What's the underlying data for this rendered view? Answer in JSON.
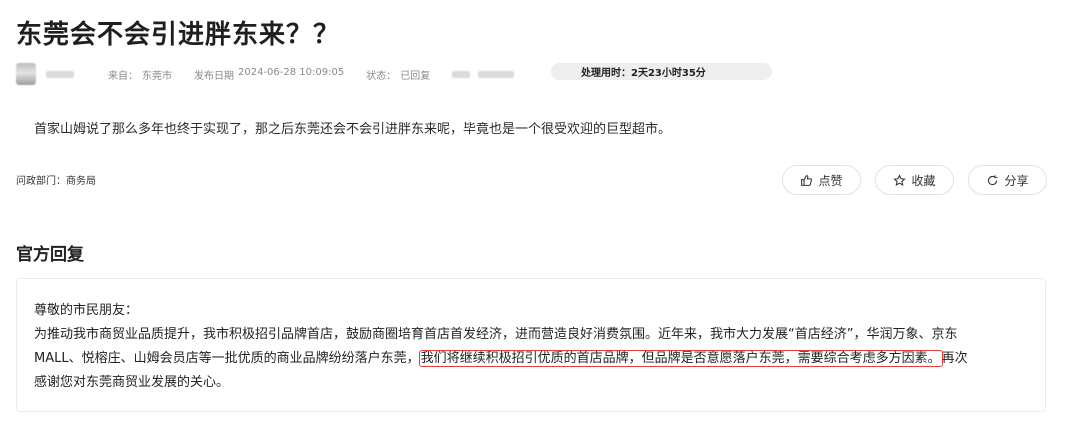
{
  "title": "东莞会不会引进胖东来？？",
  "meta": {
    "source_label": "来自：",
    "source_value": "东莞市",
    "date_label": "发布日期",
    "date_value": "2024-06-28 10:09:05",
    "status_label": "状态：",
    "status_value": "已回复",
    "timer_text": "处理用时：2天23小时35分"
  },
  "question": "首家山姆说了那么多年也终于实现了，那之后东莞还会不会引进胖东来呢，毕竟也是一个很受欢迎的巨型超市。",
  "department": "问政部门：商务局",
  "actions": {
    "like": "点赞",
    "favorite": "收藏",
    "share": "分享"
  },
  "reply": {
    "heading": "官方回复",
    "greeting": "尊敬的市民朋友：",
    "line1": "为推动我市商贸业品质提升，我市积极招引品牌首店，鼓励商圈培育首店首发经济，进而营造良好消费氛围。近年来，我市大力发展“首店经济”，华润万象、京东",
    "line2_start": "MALL、悦榕庄、山姆会员店等一批优质的商业品牌纷纷落户东莞，",
    "line2_highlight": "我们将继续积极招引优质的首店品牌，但品牌是否意愿落户东莞，需要综合考虑多方因素。",
    "line2_end": "再次",
    "line3": "感谢您对东莞商贸业发展的关心。"
  },
  "colors": {
    "highlight_border": "#e0413a",
    "timer_bg": "#eeeeee"
  }
}
